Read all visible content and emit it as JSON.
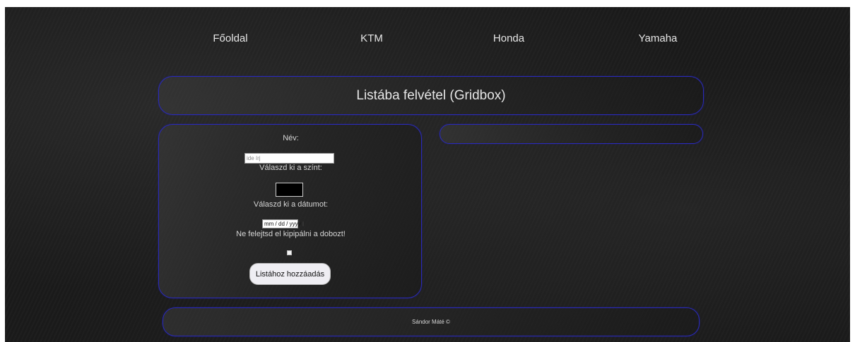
{
  "nav": {
    "items": [
      {
        "label": "Főoldal"
      },
      {
        "label": "KTM"
      },
      {
        "label": "Honda"
      },
      {
        "label": "Yamaha"
      }
    ]
  },
  "header": {
    "title": "Listába felvétel (Gridbox)"
  },
  "form": {
    "name_label": "Név:",
    "name_placeholder": "ide írj",
    "name_value": "",
    "color_label": "Válaszd ki a színt:",
    "color_value": "#000000",
    "date_label": "Válaszd ki a dátumot:",
    "date_placeholder": "mm / dd / yyyy",
    "checkbox_label": "Ne felejtsd el kipipálni a dobozt!",
    "checkbox_checked": false,
    "submit_label": "Listához hozzáadás"
  },
  "footer": {
    "text": "Sándor Máté ©"
  },
  "colors": {
    "panel_border": "#2a2ab8",
    "background": "#1b1b1b"
  }
}
